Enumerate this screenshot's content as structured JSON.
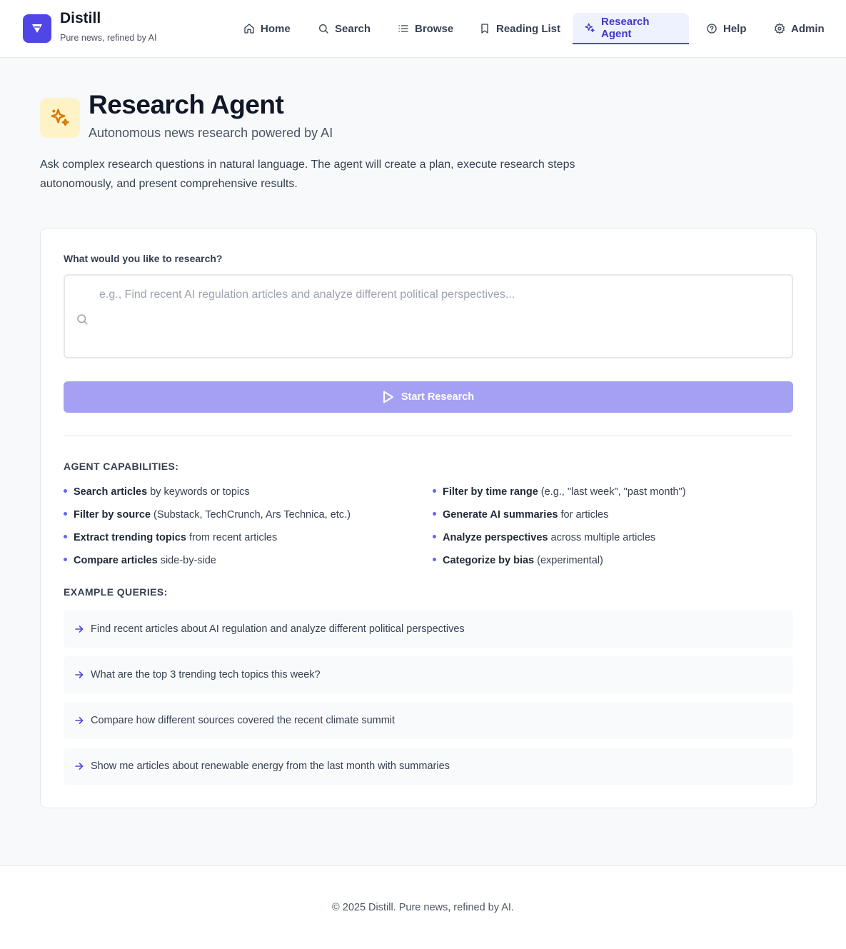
{
  "brand": {
    "name": "Distill",
    "tagline": "Pure news, refined by AI"
  },
  "nav": [
    {
      "label": "Home",
      "icon": "home-icon"
    },
    {
      "label": "Search",
      "icon": "search-icon"
    },
    {
      "label": "Browse",
      "icon": "list-icon"
    },
    {
      "label": "Reading List",
      "icon": "bookmark-icon"
    },
    {
      "label": "Research Agent",
      "icon": "sparkles-icon",
      "active": true
    },
    {
      "label": "Help",
      "icon": "help-circle-icon"
    },
    {
      "label": "Admin",
      "icon": "gear-icon"
    }
  ],
  "hero": {
    "title": "Research Agent",
    "subtitle": "Autonomous news research powered by AI",
    "description": "Ask complex research questions in natural language. The agent will create a plan, execute research steps autonomously, and present comprehensive results."
  },
  "query": {
    "label": "What would you like to research?",
    "placeholder": "e.g., Find recent AI regulation articles and analyze different political perspectives...",
    "value": "",
    "button_label": "Start Research"
  },
  "capabilities": {
    "heading": "AGENT CAPABILITIES:",
    "left": [
      {
        "bold": "Search articles",
        "rest": " by keywords or topics"
      },
      {
        "bold": "Filter by source",
        "rest": " (Substack, TechCrunch, Ars Technica, etc.)"
      },
      {
        "bold": "Extract trending topics",
        "rest": " from recent articles"
      },
      {
        "bold": "Compare articles",
        "rest": " side-by-side"
      }
    ],
    "right": [
      {
        "bold": "Filter by time range",
        "rest": " (e.g., \"last week\", \"past month\")"
      },
      {
        "bold": "Generate AI summaries",
        "rest": " for articles"
      },
      {
        "bold": "Analyze perspectives",
        "rest": " across multiple articles"
      },
      {
        "bold": "Categorize by bias",
        "rest": " (experimental)"
      }
    ]
  },
  "examples": {
    "heading": "EXAMPLE QUERIES:",
    "items": [
      "Find recent articles about AI regulation and analyze different political perspectives",
      "What are the top 3 trending tech topics this week?",
      "Compare how different sources covered the recent climate summit",
      "Show me articles about renewable energy from the last month with summaries"
    ]
  },
  "footer": {
    "text": "© 2025 Distill. Pure news, refined by AI."
  },
  "colors": {
    "accent": "#4f46e5",
    "accent_light": "#eef2ff",
    "button_disabled": "#a5a1f2",
    "hero_icon_bg": "#fef3c7",
    "hero_icon": "#d97706"
  }
}
